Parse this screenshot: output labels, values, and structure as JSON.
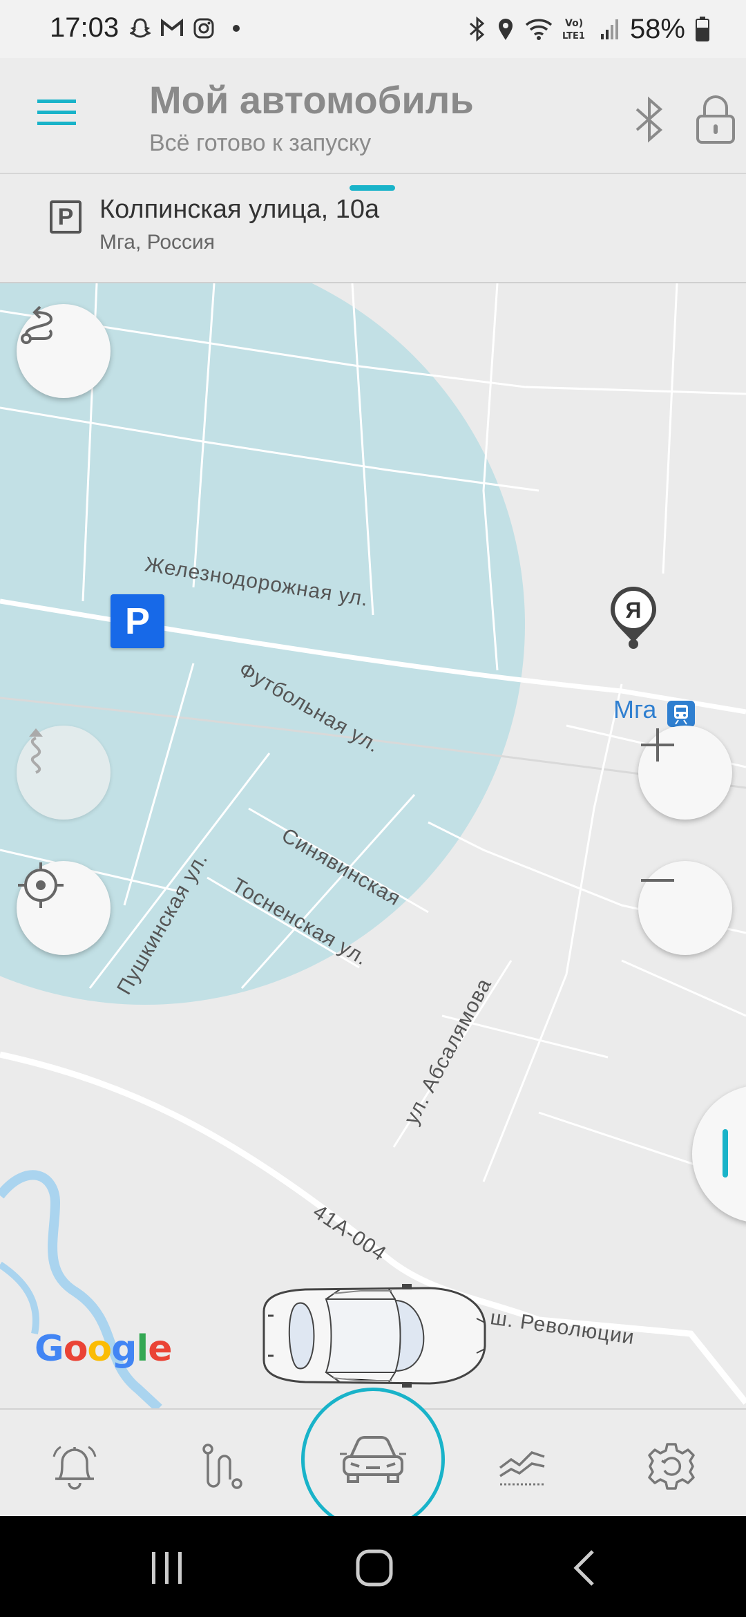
{
  "status_bar": {
    "time": "17:03",
    "notification_icons": [
      "snapchat-icon",
      "gmail-icon",
      "instagram-icon",
      "dot-icon"
    ],
    "system_icons": [
      "bluetooth-icon",
      "location-icon",
      "wifi-icon",
      "volte-lte-icon",
      "signal-icon"
    ],
    "battery_text": "58%"
  },
  "header": {
    "title": "Мой автомобиль",
    "subtitle": "Всё готово к запуску",
    "accent_color": "#19b3c9"
  },
  "address": {
    "street": "Колпинская улица, 10а",
    "city": "Мга, Россия",
    "parking_icon_letter": "P"
  },
  "map": {
    "street_labels": [
      "Железнодорожная ул.",
      "Футбольная ул.",
      "Синявинская",
      "Тосненская ул.",
      "Пушкинская ул.",
      "ул. Абсалямова",
      "41А-004",
      "ш. Революции"
    ],
    "parking_marker_letter": "P",
    "me_marker_letter": "Я",
    "station_name": "Мга",
    "zoom_in_label": "+",
    "zoom_out_label": "−",
    "google_logo": [
      "G",
      "o",
      "o",
      "g",
      "l",
      "e"
    ],
    "google_colors": [
      "#4285F4",
      "#EA4335",
      "#FBBC05",
      "#4285F4",
      "#34A853",
      "#EA4335"
    ]
  },
  "bottom_nav": {
    "items": [
      "alarm-bell-icon",
      "route-icon",
      "car-icon",
      "statistics-icon",
      "settings-icon"
    ],
    "active": "car-icon"
  },
  "system_nav": [
    "recent-apps-icon",
    "home-icon",
    "back-icon"
  ]
}
